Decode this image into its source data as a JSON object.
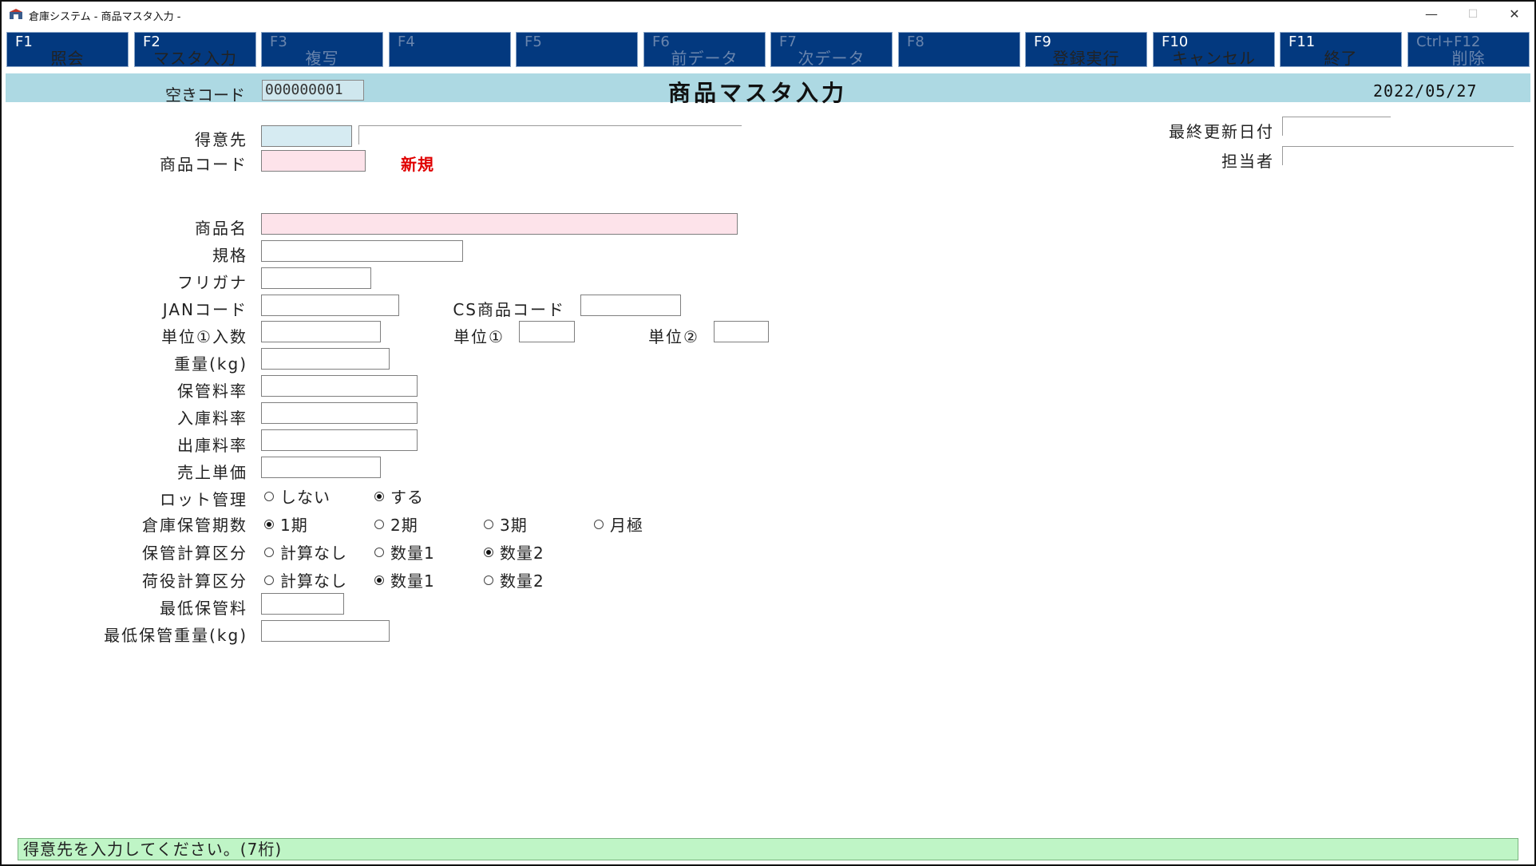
{
  "window": {
    "title": "倉庫システム - 商品マスタ入力 -",
    "min_glyph": "—",
    "max_glyph": "☐",
    "close_glyph": "✕"
  },
  "fkeys": [
    {
      "key": "F1",
      "label": "照会",
      "enabled": true
    },
    {
      "key": "F2",
      "label": "マスタ入力",
      "enabled": true
    },
    {
      "key": "F3",
      "label": "複写",
      "enabled": false
    },
    {
      "key": "F4",
      "label": "",
      "enabled": false
    },
    {
      "key": "F5",
      "label": "",
      "enabled": false
    },
    {
      "key": "F6",
      "label": "前データ",
      "enabled": false
    },
    {
      "key": "F7",
      "label": "次データ",
      "enabled": false
    },
    {
      "key": "F8",
      "label": "",
      "enabled": false
    },
    {
      "key": "F9",
      "label": "登録実行",
      "enabled": true
    },
    {
      "key": "F10",
      "label": "キャンセル",
      "enabled": true
    },
    {
      "key": "F11",
      "label": "終了",
      "enabled": true
    },
    {
      "key": "Ctrl+F12",
      "label": "削除",
      "enabled": false
    }
  ],
  "header": {
    "akicode_label": "空きコード",
    "akicode_value": "000000001",
    "screen_title": "商品マスタ入力",
    "date": "2022/05/27"
  },
  "form": {
    "tokuisaki_label": "得意先",
    "tokuisaki_value": "",
    "tokuisaki_name": "",
    "shohin_code_label": "商品コード",
    "shohin_code_value": "",
    "new_mark": "新規",
    "last_update_label": "最終更新日付",
    "last_update_value": "",
    "tanto_label": "担当者",
    "tanto_value": "",
    "shohin_name_label": "商品名",
    "kikaku_label": "規格",
    "furigana_label": "フリガナ",
    "jan_label": "JANコード",
    "cs_code_label": "CS商品コード",
    "unit1_qty_label": "単位①入数",
    "unit1_label": "単位①",
    "unit2_label": "単位②",
    "weight_label": "重量(kg)",
    "hokan_rate_label": "保管料率",
    "nyuko_rate_label": "入庫料率",
    "shukko_rate_label": "出庫料率",
    "uriage_tanka_label": "売上単価",
    "lot_label": "ロット管理",
    "lot_options": [
      "しない",
      "する"
    ],
    "lot_selected": "する",
    "kikan_label": "倉庫保管期数",
    "kikan_options": [
      "1期",
      "2期",
      "3期",
      "月極"
    ],
    "kikan_selected": "1期",
    "hokan_calc_label": "保管計算区分",
    "hokan_calc_options": [
      "計算なし",
      "数量1",
      "数量2"
    ],
    "hokan_calc_selected": "数量2",
    "niyaku_calc_label": "荷役計算区分",
    "niyaku_calc_options": [
      "計算なし",
      "数量1",
      "数量2"
    ],
    "niyaku_calc_selected": "数量1",
    "min_hokan_fee_label": "最低保管料",
    "min_hokan_weight_label": "最低保管重量(kg)"
  },
  "status": {
    "message": "得意先を入力してください。(7桁)"
  },
  "colors": {
    "fkey_bg": "#03397f",
    "header_band": "#add9e3",
    "status_bg": "#bff5c6",
    "required_pink": "#fde3ea",
    "key_blue": "#d6ebf2",
    "new_red": "#e00000"
  }
}
